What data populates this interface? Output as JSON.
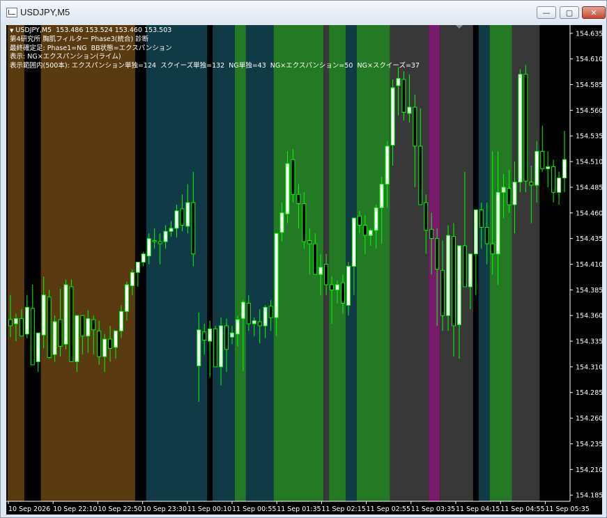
{
  "window": {
    "title": "USDJPY,M5",
    "min_label": "—",
    "max_label": "▢",
    "close_label": "✕"
  },
  "chart": {
    "header": "USDJPY,M5  153.486 153.524 153.460 153.503",
    "info_lines": [
      "第4研究所 胸肌フィルター Phase3(統合) 診断",
      "最終確定足: Phase1=NG  BB状態=エクスパンション",
      "表示: NG×エクスパンション(ライム)",
      "表示範囲内(500本): エクスパンション単独=124  スクイーズ単独=132  NG単独=43  NG×エクスパンション=50  NG×スクイーズ=37"
    ]
  },
  "chart_data": {
    "type": "candlestick",
    "symbol": "USDJPY",
    "timeframe": "M5",
    "y_ticks": [
      154.635,
      154.61,
      154.585,
      154.56,
      154.535,
      154.51,
      154.485,
      154.46,
      154.435,
      154.41,
      154.385,
      154.36,
      154.335,
      154.31,
      154.285,
      154.26,
      154.235,
      154.21,
      154.185
    ],
    "ylim": [
      154.179,
      154.643
    ],
    "x_ticks": [
      "10 Sep 2026",
      "10 Sep 22:10",
      "10 Sep 22:50",
      "10 Sep 23:30",
      "11 Sep 00:10",
      "11 Sep 00:55",
      "11 Sep 01:35",
      "11 Sep 02:15",
      "11 Sep 02:55",
      "11 Sep 03:35",
      "11 Sep 04:15",
      "11 Sep 04:55",
      "11 Sep 05:35"
    ],
    "bar_count": 101,
    "colors": {
      "bull": "#ffffff",
      "bear": "#000000",
      "wick": "#00ff00",
      "axis": "#ffffff",
      "background": "#000000"
    },
    "bands": [
      {
        "from": 0,
        "to": 3,
        "color": "#5a3a10"
      },
      {
        "from": 6,
        "to": 23,
        "color": "#5a3a10"
      },
      {
        "from": 25,
        "to": 36,
        "color": "#103a45"
      },
      {
        "from": 37,
        "to": 41,
        "color": "#103a45"
      },
      {
        "from": 41,
        "to": 43,
        "color": "#247a24"
      },
      {
        "from": 43,
        "to": 48,
        "color": "#103a45"
      },
      {
        "from": 48,
        "to": 57,
        "color": "#247a24"
      },
      {
        "from": 57,
        "to": 58,
        "color": "#383838"
      },
      {
        "from": 58,
        "to": 61,
        "color": "#247a24"
      },
      {
        "from": 61,
        "to": 63,
        "color": "#103a45"
      },
      {
        "from": 63,
        "to": 69,
        "color": "#247a24"
      },
      {
        "from": 69,
        "to": 76,
        "color": "#383838"
      },
      {
        "from": 76,
        "to": 78,
        "color": "#7a1a6a"
      },
      {
        "from": 78,
        "to": 84,
        "color": "#383838"
      },
      {
        "from": 85,
        "to": 87,
        "color": "#103a45"
      },
      {
        "from": 87,
        "to": 91,
        "color": "#247a24"
      },
      {
        "from": 91,
        "to": 96,
        "color": "#383838"
      }
    ],
    "candles": [
      [
        154.356,
        154.38,
        154.339,
        154.35
      ],
      [
        154.352,
        154.362,
        154.335,
        154.357
      ],
      [
        154.357,
        154.366,
        154.345,
        154.34
      ],
      [
        154.342,
        154.38,
        154.338,
        154.368
      ],
      [
        154.367,
        154.39,
        154.315,
        154.312
      ],
      [
        154.315,
        154.342,
        154.305,
        154.343
      ],
      [
        154.341,
        154.398,
        154.328,
        154.38
      ],
      [
        154.378,
        154.385,
        154.318,
        154.319
      ],
      [
        154.322,
        154.36,
        154.315,
        154.354
      ],
      [
        154.356,
        154.386,
        154.32,
        154.33
      ],
      [
        154.332,
        154.395,
        154.327,
        154.39
      ],
      [
        154.388,
        154.395,
        154.318,
        154.315
      ],
      [
        154.315,
        154.356,
        154.305,
        154.36
      ],
      [
        154.36,
        154.36,
        154.322,
        154.34
      ],
      [
        154.34,
        154.365,
        154.324,
        154.357
      ],
      [
        154.356,
        154.36,
        154.322,
        154.346
      ],
      [
        154.345,
        154.355,
        154.312,
        154.32
      ],
      [
        154.32,
        154.342,
        154.305,
        154.337
      ],
      [
        154.337,
        154.35,
        154.315,
        154.328
      ],
      [
        154.329,
        154.34,
        154.318,
        154.345
      ],
      [
        154.345,
        154.37,
        154.338,
        154.364
      ],
      [
        154.364,
        154.393,
        154.355,
        154.39
      ],
      [
        154.389,
        154.405,
        154.38,
        154.402
      ],
      [
        154.402,
        154.412,
        154.388,
        154.412
      ],
      [
        154.412,
        154.422,
        154.408,
        154.42
      ],
      [
        154.418,
        154.44,
        154.41,
        154.435
      ],
      [
        154.433,
        154.445,
        154.425,
        154.432
      ],
      [
        154.432,
        154.44,
        154.41,
        154.43
      ],
      [
        154.432,
        154.448,
        154.425,
        154.442
      ],
      [
        154.442,
        154.452,
        154.437,
        154.445
      ],
      [
        154.445,
        154.468,
        154.436,
        154.462
      ],
      [
        154.464,
        154.478,
        154.442,
        154.448
      ],
      [
        154.447,
        154.488,
        154.44,
        154.47
      ],
      [
        154.47,
        154.5,
        154.408,
        154.42
      ],
      [
        154.311,
        154.363,
        154.276,
        154.346
      ],
      [
        154.344,
        154.352,
        154.322,
        154.336
      ],
      [
        154.335,
        154.355,
        154.3,
        154.347
      ],
      [
        154.347,
        154.35,
        154.324,
        154.31
      ],
      [
        154.31,
        154.358,
        154.292,
        154.35
      ],
      [
        154.35,
        154.357,
        154.305,
        154.327
      ],
      [
        154.339,
        154.35,
        154.332,
        154.343
      ],
      [
        154.342,
        154.36,
        154.33,
        154.356
      ],
      [
        154.357,
        154.375,
        154.306,
        154.373
      ],
      [
        154.372,
        154.38,
        154.345,
        154.352
      ],
      [
        154.352,
        154.358,
        154.34,
        154.355
      ],
      [
        154.354,
        154.366,
        154.333,
        154.35
      ],
      [
        154.35,
        154.37,
        154.338,
        154.368
      ],
      [
        154.369,
        154.375,
        154.345,
        154.358
      ],
      [
        154.358,
        154.438,
        154.34,
        154.44
      ],
      [
        154.441,
        154.47,
        154.432,
        154.46
      ],
      [
        154.459,
        154.52,
        154.45,
        154.508
      ],
      [
        154.512,
        154.522,
        154.47,
        154.478
      ],
      [
        154.478,
        154.488,
        154.445,
        154.469
      ],
      [
        154.469,
        154.48,
        154.425,
        154.432
      ],
      [
        154.433,
        154.445,
        154.4,
        154.43
      ],
      [
        154.43,
        154.44,
        154.405,
        154.4
      ],
      [
        154.4,
        154.42,
        154.38,
        154.407
      ],
      [
        154.41,
        154.42,
        154.38,
        154.39
      ],
      [
        154.39,
        154.398,
        154.352,
        154.385
      ],
      [
        154.385,
        154.394,
        154.372,
        154.39
      ],
      [
        154.392,
        154.4,
        154.362,
        154.372
      ],
      [
        154.37,
        154.412,
        154.36,
        154.408
      ],
      [
        154.408,
        154.444,
        154.38,
        154.455
      ],
      [
        154.457,
        154.462,
        154.44,
        154.448
      ],
      [
        154.448,
        154.458,
        154.42,
        154.438
      ],
      [
        154.438,
        154.445,
        154.428,
        154.443
      ],
      [
        154.443,
        154.468,
        154.425,
        154.465
      ],
      [
        154.465,
        154.495,
        154.43,
        154.488
      ],
      [
        154.488,
        154.53,
        154.465,
        154.525
      ],
      [
        154.526,
        154.59,
        154.506,
        154.582
      ],
      [
        154.584,
        154.602,
        154.555,
        154.591
      ],
      [
        154.59,
        154.598,
        154.55,
        154.558
      ],
      [
        154.557,
        154.595,
        154.548,
        154.563
      ],
      [
        154.563,
        154.575,
        154.485,
        154.525
      ],
      [
        154.525,
        154.562,
        154.478,
        154.468
      ],
      [
        154.47,
        154.478,
        154.42,
        154.443
      ],
      [
        154.444,
        154.46,
        154.4,
        154.435
      ],
      [
        154.435,
        154.445,
        154.35,
        154.405
      ],
      [
        154.404,
        154.433,
        154.345,
        154.36
      ],
      [
        154.36,
        154.448,
        154.345,
        154.438
      ],
      [
        154.437,
        154.45,
        154.32,
        154.35
      ],
      [
        154.351,
        154.4,
        154.318,
        154.428
      ],
      [
        154.428,
        154.5,
        154.4,
        154.388
      ],
      [
        154.388,
        154.42,
        154.366,
        154.42
      ],
      [
        154.42,
        154.44,
        154.38,
        154.463
      ],
      [
        154.463,
        154.47,
        154.425,
        154.446
      ],
      [
        154.446,
        154.47,
        154.41,
        154.43
      ],
      [
        154.43,
        154.52,
        154.4,
        154.42
      ],
      [
        154.42,
        154.52,
        154.39,
        154.48
      ],
      [
        154.48,
        154.498,
        154.455,
        154.485
      ],
      [
        154.484,
        154.502,
        154.46,
        154.468
      ],
      [
        154.468,
        154.51,
        154.44,
        154.49
      ],
      [
        154.49,
        154.6,
        154.48,
        154.595
      ],
      [
        154.595,
        154.604,
        154.48,
        154.491
      ],
      [
        154.49,
        154.506,
        154.45,
        154.487
      ],
      [
        154.487,
        154.53,
        154.47,
        154.52
      ],
      [
        154.52,
        154.545,
        154.5,
        154.503
      ],
      [
        154.503,
        154.52,
        154.485,
        154.505
      ],
      [
        154.505,
        154.512,
        154.47,
        154.48
      ],
      [
        154.48,
        154.5,
        154.468,
        154.494
      ],
      [
        154.494,
        154.54,
        154.48,
        154.512
      ]
    ]
  }
}
